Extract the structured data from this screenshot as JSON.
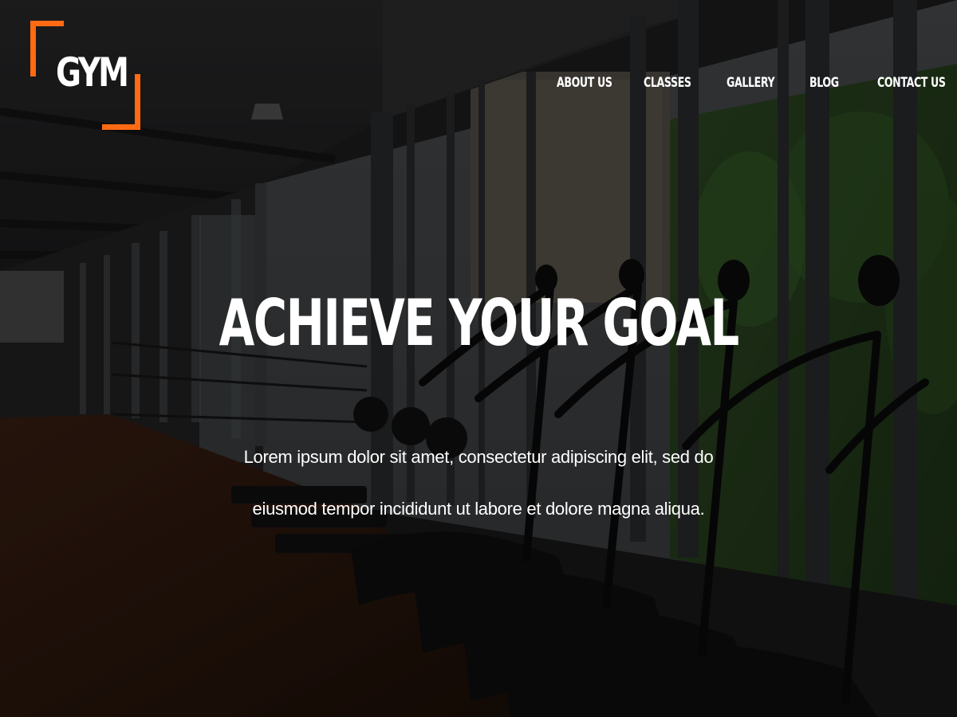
{
  "logo": {
    "text": "GYM",
    "accent_color": "#ff6a13"
  },
  "nav": {
    "items": [
      {
        "label": "ABOUT US"
      },
      {
        "label": "CLASSES"
      },
      {
        "label": "GALLERY"
      },
      {
        "label": "BLOG"
      },
      {
        "label": "CONTACT US"
      }
    ]
  },
  "hero": {
    "headline": "ACHIEVE YOUR GOAL",
    "body_line_1": "Lorem ipsum dolor sit amet, consectetur adipiscing elit, sed do",
    "body_line_2": "eiusmod tempor incididunt ut labore et dolore magna aliqua.",
    "text_color": "#ffffff"
  }
}
